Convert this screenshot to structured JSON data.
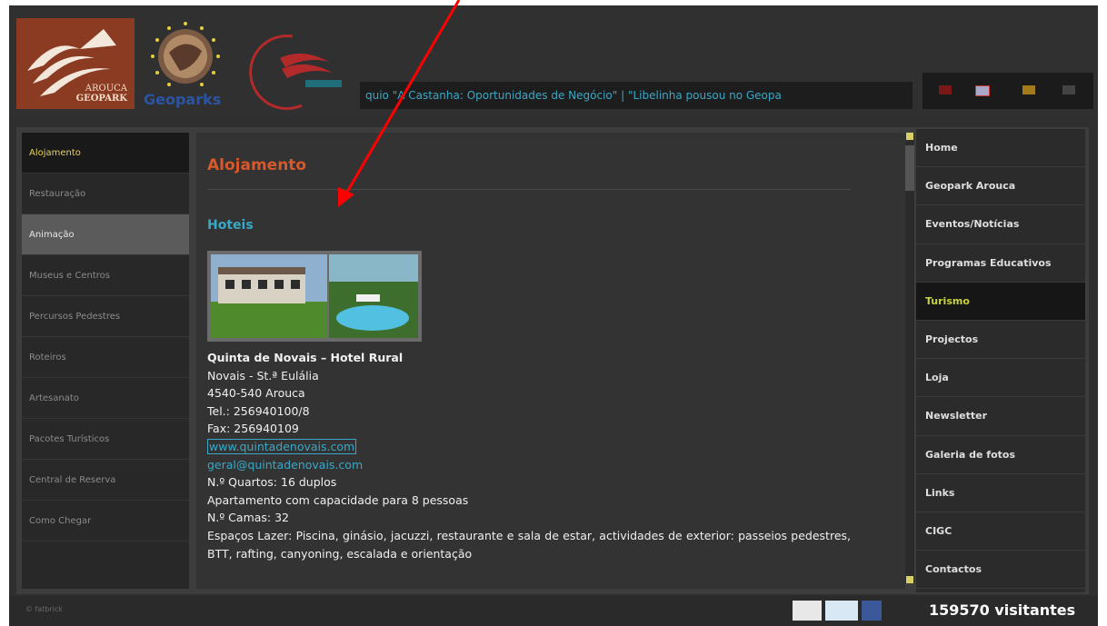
{
  "header": {
    "logo_line1": "AROUCA",
    "logo_line2": "GEOPARK",
    "geoparks_text": "Geoparks",
    "ticker_text": "quio \"A Castanha: Oportunidades de Negócio\"   |  \"Libelinha pousou no Geopa"
  },
  "left_nav": {
    "items": [
      {
        "label": "Alojamento",
        "state": "active"
      },
      {
        "label": "Restauração",
        "state": "normal"
      },
      {
        "label": "Animação",
        "state": "hover"
      },
      {
        "label": "Museus e Centros",
        "state": "normal"
      },
      {
        "label": "Percursos Pedestres",
        "state": "normal"
      },
      {
        "label": "Roteiros",
        "state": "normal"
      },
      {
        "label": "Artesanato",
        "state": "normal"
      },
      {
        "label": "Pacotes Turísticos",
        "state": "normal"
      },
      {
        "label": "Central de Reserva",
        "state": "normal"
      },
      {
        "label": "Como Chegar",
        "state": "normal"
      }
    ]
  },
  "main": {
    "title": "Alojamento",
    "section": "Hoteis",
    "hotel": {
      "name": "Quinta de Novais – Hotel Rural",
      "address1": "Novais - St.ª Eulália",
      "address2": "4540-540 Arouca",
      "tel": "Tel.: 256940100/8",
      "fax": "Fax: 256940109",
      "website": "www.quintadenovais.com",
      "email": "geral@quintadenovais.com",
      "rooms": "N.º Quartos: 16 duplos",
      "apartment": "Apartamento com capacidade para 8 pessoas",
      "beds": "N.º Camas: 32",
      "leisure": "Espaços Lazer: Piscina, ginásio, jacuzzi, restaurante e sala de estar, actividades de exterior: passeios pedestres, BTT, rafting, canyoning, escalada e orientação"
    }
  },
  "right_nav": {
    "items": [
      {
        "label": "Home",
        "active": false
      },
      {
        "label": "Geopark Arouca",
        "active": false
      },
      {
        "label": "Eventos/Notícias",
        "active": false
      },
      {
        "label": "Programas Educativos",
        "active": false
      },
      {
        "label": "Turismo",
        "active": true
      },
      {
        "label": "Projectos",
        "active": false
      },
      {
        "label": "Loja",
        "active": false
      },
      {
        "label": "Newsletter",
        "active": false
      },
      {
        "label": "Galeria de fotos",
        "active": false
      },
      {
        "label": "Links",
        "active": false
      },
      {
        "label": "CIGC",
        "active": false
      },
      {
        "label": "Contactos",
        "active": false
      }
    ]
  },
  "footer": {
    "brand": "© fatbrick",
    "visitors": "159570 visitantes"
  },
  "colors": {
    "accent_title": "#d9582a",
    "link": "#39a8c6",
    "active_left": "#e9d25b",
    "active_right": "#c9d33a",
    "annotation_arrow": "#ff0000"
  }
}
